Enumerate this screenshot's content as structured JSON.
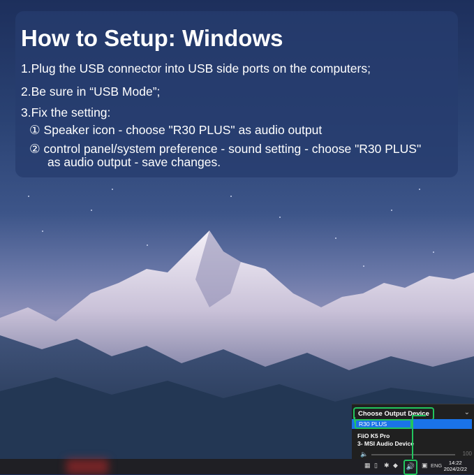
{
  "panel": {
    "title": "How to Setup: Windows",
    "step1": "1.Plug the USB connector into USB side ports on the computers;",
    "step2": "2.Be sure in “USB Mode”;",
    "step3": "3.Fix the setting:",
    "sub1": "① Speaker icon - choose \"R30 PLUS\" as audio output",
    "sub2a": "② control panel/system preference - sound setting - choose \"R30 PLUS\"",
    "sub2b": "as audio output - save changes."
  },
  "flyout": {
    "header": "Choose Output Device",
    "chevron": "⌄",
    "selected_device": "R30 PLUS",
    "devices": [
      "FiiO K5 Pro",
      "3- MSI Audio Device"
    ],
    "volume_value": "100"
  },
  "taskbar": {
    "language": "ENG",
    "time": "14:22",
    "date": "2024/2/22"
  }
}
